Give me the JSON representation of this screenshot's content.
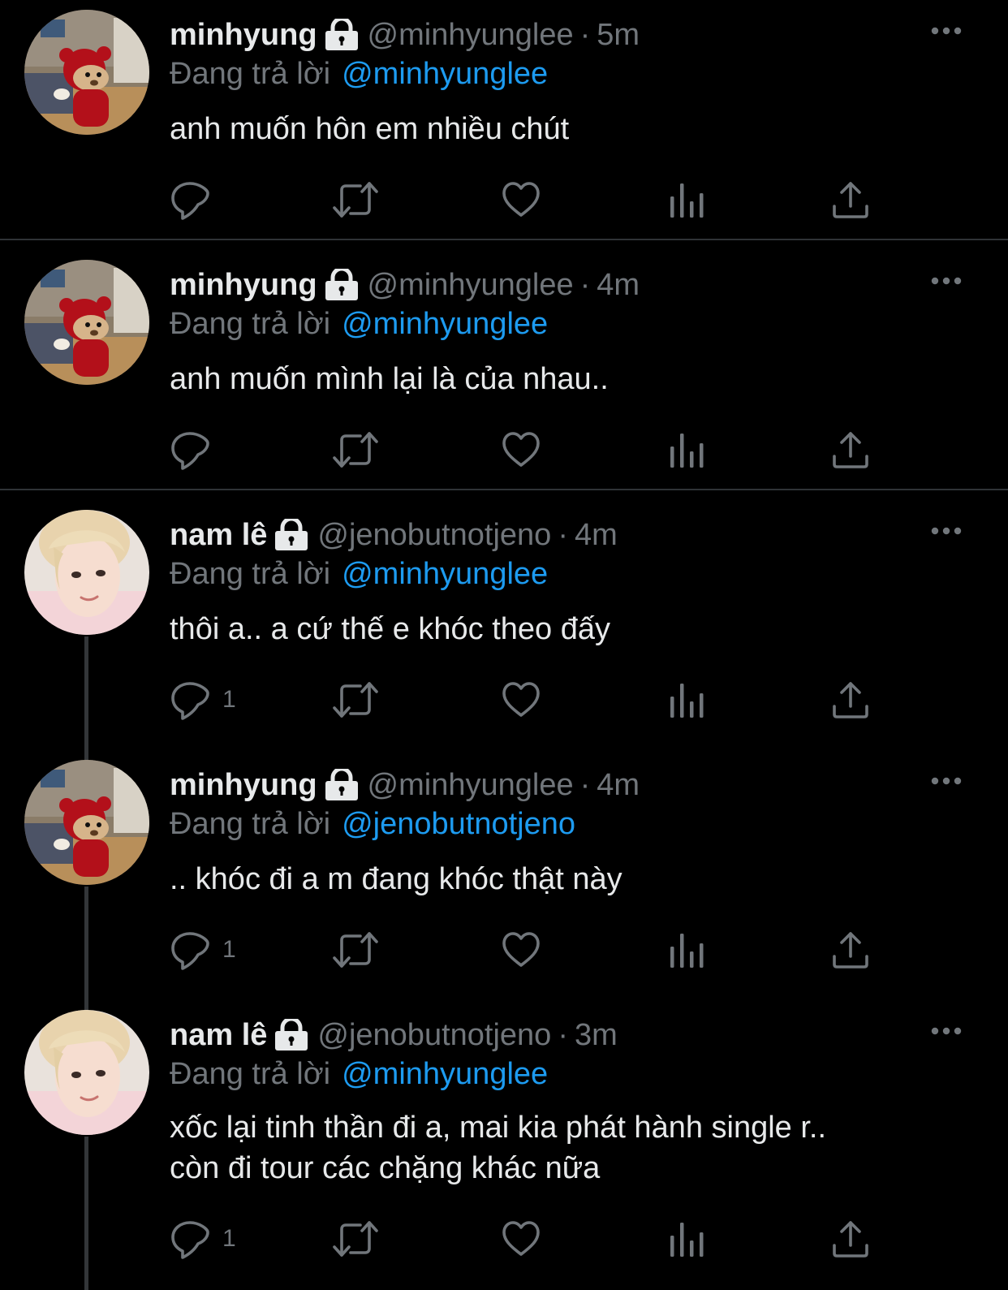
{
  "tweets": [
    {
      "name": "minhyung",
      "handle": "@minhyunglee",
      "time": "5m",
      "reply_prefix": "Đang trả lời",
      "reply_to": "@minhyunglee",
      "text": "anh muốn hôn em nhiều chút",
      "reply_count": "",
      "avatar": "bear-doll-avatar"
    },
    {
      "name": "minhyung",
      "handle": "@minhyunglee",
      "time": "4m",
      "reply_prefix": "Đang trả lời",
      "reply_to": "@minhyunglee",
      "text": "anh muốn mình lại là của nhau..",
      "reply_count": "",
      "avatar": "bear-doll-avatar"
    },
    {
      "name": "nam lê",
      "handle": "@jenobutnotjeno",
      "time": "4m",
      "reply_prefix": "Đang trả lời",
      "reply_to": "@minhyunglee",
      "text": "thôi a.. a cứ thế e khóc theo đấy",
      "reply_count": "1",
      "avatar": "blond-person-avatar"
    },
    {
      "name": "minhyung",
      "handle": "@minhyunglee",
      "time": "4m",
      "reply_prefix": "Đang trả lời",
      "reply_to": "@jenobutnotjeno",
      "text": ".. khóc đi a m đang khóc thật này",
      "reply_count": "1",
      "avatar": "bear-doll-avatar"
    },
    {
      "name": "nam lê",
      "handle": "@jenobutnotjeno",
      "time": "3m",
      "reply_prefix": "Đang trả lời",
      "reply_to": "@minhyunglee",
      "text_lines": [
        "xốc lại tinh thần đi a, mai kia phát hành single r..",
        "còn đi tour các chặng khác nữa"
      ],
      "reply_count": "1",
      "avatar": "blond-person-avatar"
    }
  ],
  "separator": "·",
  "colors": {
    "background": "#000000",
    "text": "#e7e9ea",
    "muted": "#71767b",
    "mention": "#1d9bf0",
    "divider": "#2f3336"
  },
  "icons": [
    "lock-icon",
    "more-icon",
    "reply-icon",
    "retweet-icon",
    "like-icon",
    "views-icon",
    "share-icon"
  ]
}
